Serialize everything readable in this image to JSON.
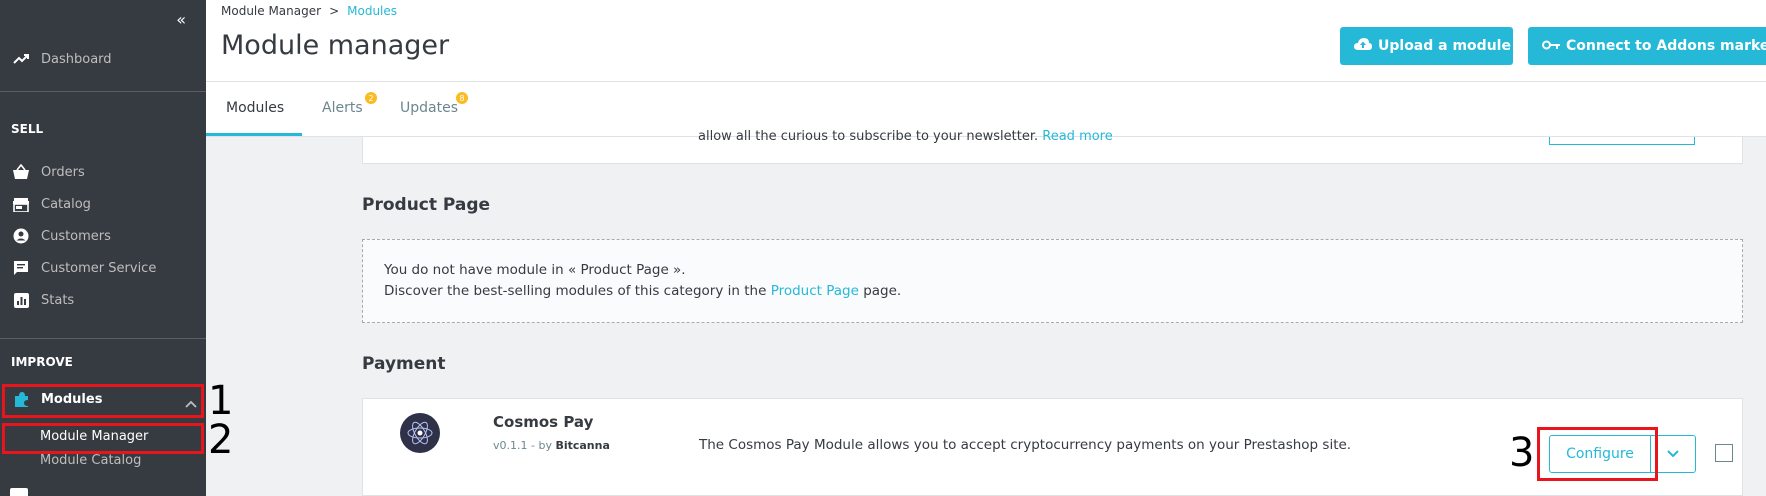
{
  "sidebar": {
    "collapse_glyph": "«",
    "dashboard": "Dashboard",
    "sell_section": "SELL",
    "orders": "Orders",
    "catalog": "Catalog",
    "customers": "Customers",
    "customer_service": "Customer Service",
    "stats": "Stats",
    "improve_section": "IMPROVE",
    "modules": "Modules",
    "module_manager": "Module Manager",
    "module_catalog": "Module Catalog"
  },
  "annotations": {
    "one": "1",
    "two": "2",
    "three": "3"
  },
  "header": {
    "breadcrumb_parent": "Module Manager",
    "breadcrumb_sep": ">",
    "breadcrumb_current": "Modules",
    "title": "Module manager",
    "upload_button": "Upload a module",
    "connect_button": "Connect to Addons marketpla"
  },
  "tabs": {
    "modules": "Modules",
    "alerts": "Alerts",
    "alerts_count": "2",
    "updates": "Updates",
    "updates_count": "8"
  },
  "content": {
    "cut_text": "allow all the curious to subscribe to your newsletter.",
    "cut_link": "Read more",
    "product_page_title": "Product Page",
    "empty_line1": "You do not have module in « Product Page ».",
    "empty_line2_pre": "Discover the best-selling modules of this category in the",
    "empty_line2_link": "Product Page",
    "empty_line2_post": "page.",
    "payment_title": "Payment",
    "module": {
      "name": "Cosmos Pay",
      "version": "v0.1.1 - by",
      "author": "Bitcanna",
      "description": "The Cosmos Pay Module allows you to accept cryptocurrency payments on your Prestashop site.",
      "configure_button": "Configure"
    }
  },
  "colors": {
    "accent": "#25b9d7",
    "sidebar_bg": "#363a41",
    "highlight_red": "#e8161c",
    "badge": "#fbbb22"
  }
}
